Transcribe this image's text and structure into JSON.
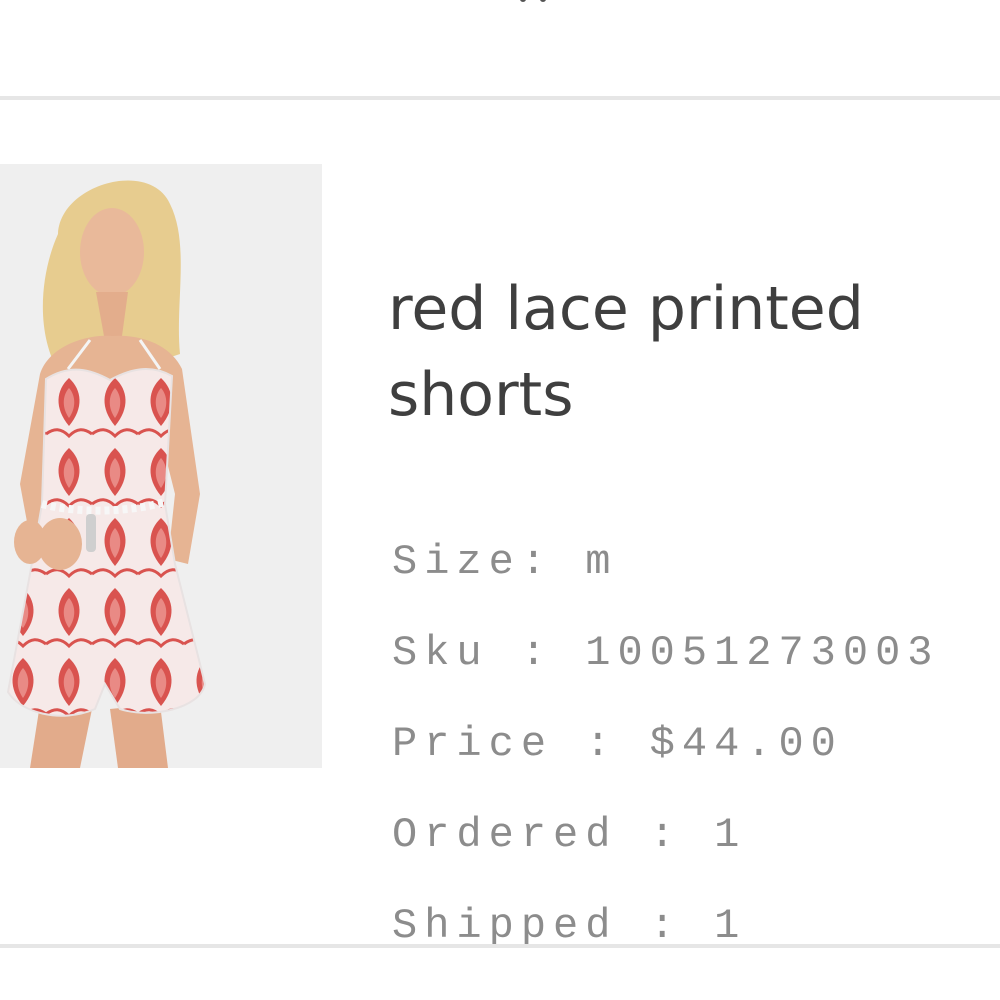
{
  "item": {
    "title": "red lace printed shorts",
    "image_alt": "model wearing red lace printed shorts playsuit",
    "details": [
      {
        "label": "Size",
        "separator": ": ",
        "value": "m"
      },
      {
        "label": "Sku",
        "separator": " : ",
        "value": "10051273003"
      },
      {
        "label": "Price",
        "separator": " : ",
        "value": "$44.00"
      },
      {
        "label": "Ordered",
        "separator": " : ",
        "value": "1"
      },
      {
        "label": "Shipped",
        "separator": " : ",
        "value": "1"
      }
    ]
  },
  "colors": {
    "title_text": "#3f3f3f",
    "detail_text": "#8c8c8c",
    "divider": "#e6e6e6",
    "garment_red": "#d9534f"
  }
}
